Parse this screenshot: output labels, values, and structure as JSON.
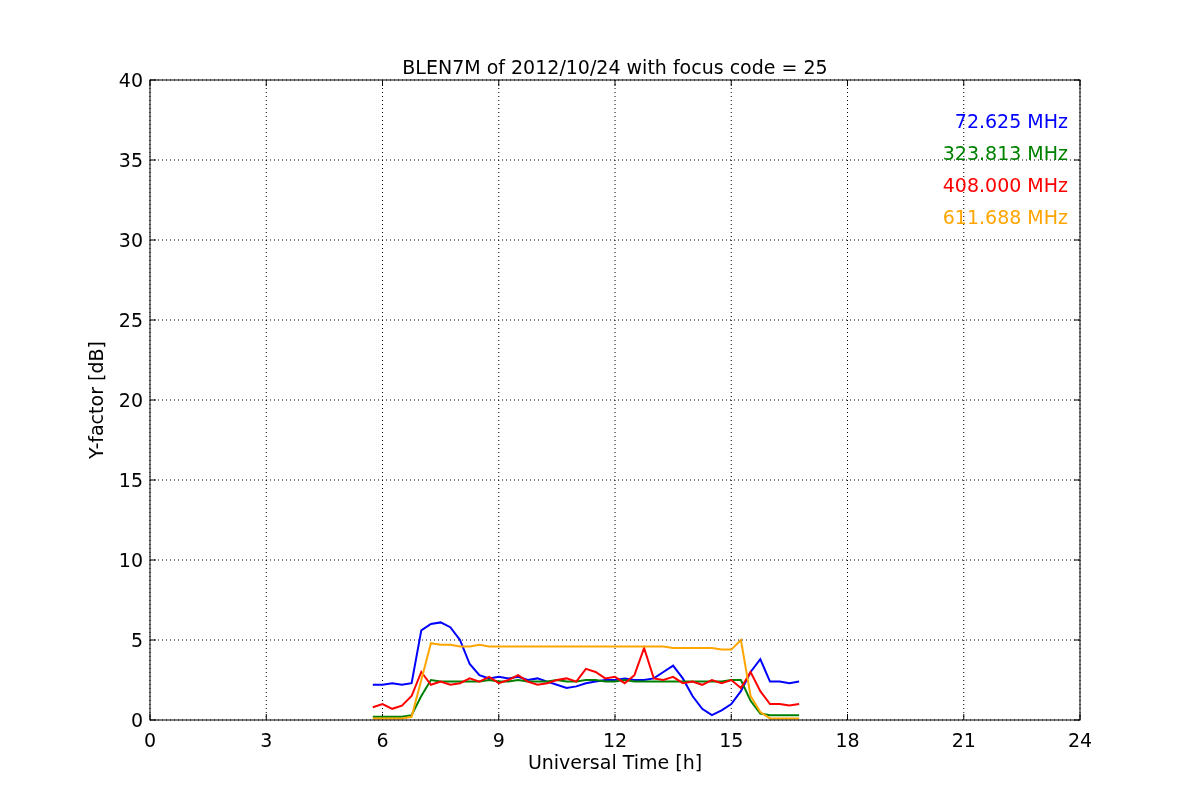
{
  "chart_data": {
    "type": "line",
    "title": "BLEN7M of 2012/10/24 with focus code = 25",
    "xlabel": "Universal Time [h]",
    "ylabel": "Y-factor [dB]",
    "x": [
      5.75,
      6,
      6.25,
      6.5,
      6.75,
      7,
      7.25,
      7.5,
      7.75,
      8,
      8.25,
      8.5,
      8.75,
      9,
      9.25,
      9.5,
      9.75,
      10,
      10.25,
      10.5,
      10.75,
      11,
      11.25,
      11.5,
      11.75,
      12,
      12.25,
      12.5,
      12.75,
      13,
      13.25,
      13.5,
      13.75,
      14,
      14.25,
      14.5,
      14.75,
      15,
      15.25,
      15.5,
      15.75,
      16,
      16.25,
      16.5,
      16.75
    ],
    "series": [
      {
        "name": "72.625 MHz",
        "color": "#0000ff",
        "values": [
          2.2,
          2.2,
          2.3,
          2.2,
          2.3,
          5.6,
          6.0,
          6.1,
          5.8,
          5.0,
          3.5,
          2.8,
          2.6,
          2.7,
          2.6,
          2.7,
          2.5,
          2.6,
          2.4,
          2.2,
          2.0,
          2.1,
          2.3,
          2.4,
          2.5,
          2.5,
          2.6,
          2.5,
          2.5,
          2.6,
          3.0,
          3.4,
          2.6,
          1.5,
          0.7,
          0.3,
          0.6,
          1.0,
          1.8,
          3.0,
          3.8,
          2.4,
          2.4,
          2.3,
          2.4
        ]
      },
      {
        "name": "323.813 MHz",
        "color": "#008000",
        "values": [
          0.2,
          0.2,
          0.2,
          0.2,
          0.3,
          1.5,
          2.5,
          2.4,
          2.4,
          2.4,
          2.4,
          2.4,
          2.5,
          2.4,
          2.4,
          2.5,
          2.4,
          2.4,
          2.4,
          2.5,
          2.4,
          2.4,
          2.5,
          2.5,
          2.4,
          2.4,
          2.5,
          2.4,
          2.4,
          2.4,
          2.4,
          2.4,
          2.4,
          2.4,
          2.4,
          2.4,
          2.4,
          2.5,
          2.5,
          1.2,
          0.4,
          0.3,
          0.3,
          0.3,
          0.3
        ]
      },
      {
        "name": "408.000 MHz",
        "color": "#ff0000",
        "values": [
          0.8,
          1.0,
          0.7,
          0.9,
          1.5,
          3.0,
          2.2,
          2.4,
          2.2,
          2.3,
          2.6,
          2.4,
          2.7,
          2.3,
          2.5,
          2.8,
          2.4,
          2.2,
          2.3,
          2.5,
          2.6,
          2.4,
          3.2,
          3.0,
          2.6,
          2.7,
          2.3,
          2.8,
          4.5,
          2.6,
          2.5,
          2.7,
          2.3,
          2.4,
          2.2,
          2.5,
          2.3,
          2.5,
          2.0,
          3.0,
          1.8,
          1.0,
          1.0,
          0.9,
          1.0
        ]
      },
      {
        "name": "611.688 MHz",
        "color": "#ffa500",
        "values": [
          0.1,
          0.1,
          0.1,
          0.1,
          0.2,
          2.5,
          4.8,
          4.7,
          4.7,
          4.6,
          4.6,
          4.7,
          4.6,
          4.6,
          4.6,
          4.6,
          4.6,
          4.6,
          4.6,
          4.6,
          4.6,
          4.6,
          4.6,
          4.6,
          4.6,
          4.6,
          4.6,
          4.6,
          4.6,
          4.6,
          4.6,
          4.5,
          4.5,
          4.5,
          4.5,
          4.5,
          4.4,
          4.4,
          5.0,
          1.5,
          0.5,
          0.1,
          0.1,
          0.1,
          0.1
        ]
      }
    ],
    "grid": true,
    "xlim": [
      0,
      24
    ],
    "ylim": [
      0,
      40
    ],
    "xticks": [
      0,
      3,
      6,
      9,
      12,
      15,
      18,
      21,
      24
    ],
    "yticks": [
      0,
      5,
      10,
      15,
      20,
      25,
      30,
      35,
      40
    ]
  }
}
